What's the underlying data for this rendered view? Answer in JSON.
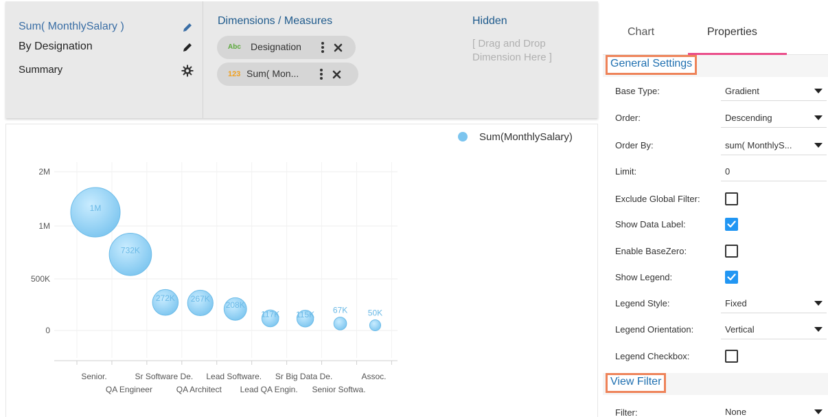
{
  "config": {
    "left": {
      "title": "Sum( MonthlySalary )",
      "by": "By Designation",
      "summary": "Summary"
    },
    "dimensions": {
      "heading": "Dimensions / Measures",
      "chips": [
        {
          "tag": "Abc",
          "label": "Designation"
        },
        {
          "tag": "123",
          "label": "Sum( Mon..."
        }
      ]
    },
    "hidden": {
      "heading": "Hidden",
      "hint": "[ Drag and Drop Dimension Here ]"
    }
  },
  "colors": {
    "bubble": "#7cc5ef",
    "accent_tab": "#ea4c89",
    "section_border": "#ee8359",
    "checkbox": "#2196f3",
    "tag_abc": "#5aa83a",
    "tag_123": "#f0a020"
  },
  "chart_data": {
    "type": "scatter",
    "legend": "Sum(MonthlySalary)",
    "legend_position": "top-right",
    "y_ticks": [
      "2M",
      "1M",
      "500K",
      "0"
    ],
    "x_tick_labels_row1": [
      "Senior.",
      "Sr Software De.",
      "Lead Software.",
      "Sr Big Data De.",
      "Assoc."
    ],
    "x_tick_labels_row2": [
      "QA Engineer",
      "QA Architect",
      "Lead QA Engin.",
      "Senior Softwa."
    ],
    "categories": [
      "Senior.",
      "QA Engineer",
      "Sr Software De.",
      "QA Architect",
      "Lead Software.",
      "Lead QA Engin.",
      "Sr Big Data De.",
      "Senior Softwa.",
      "Assoc."
    ],
    "values": [
      1000000,
      732000,
      272000,
      267000,
      208000,
      117000,
      115000,
      67000,
      50000
    ],
    "labels": [
      "1M",
      "732K",
      "272K",
      "267K",
      "208K",
      "117K",
      "115K",
      "67K",
      "50K"
    ],
    "grid": true
  },
  "properties": {
    "tabs": [
      "Chart",
      "Properties"
    ],
    "active_tab": "Properties",
    "general_settings": "General Settings",
    "view_filter": "View Filter",
    "rows": [
      {
        "label": "Base Type:",
        "kind": "dropdown",
        "value": "Gradient"
      },
      {
        "label": "Order:",
        "kind": "dropdown",
        "value": "Descending"
      },
      {
        "label": "Order By:",
        "kind": "dropdown",
        "value": "sum( MonthlyS..."
      },
      {
        "label": "Limit:",
        "kind": "input",
        "value": "0"
      },
      {
        "label": "Exclude Global Filter:",
        "kind": "checkbox",
        "checked": false
      },
      {
        "label": "Show Data Label:",
        "kind": "checkbox",
        "checked": true
      },
      {
        "label": "Enable BaseZero:",
        "kind": "checkbox",
        "checked": false
      },
      {
        "label": "Show Legend:",
        "kind": "checkbox",
        "checked": true
      },
      {
        "label": "Legend Style:",
        "kind": "dropdown",
        "value": "Fixed"
      },
      {
        "label": "Legend Orientation:",
        "kind": "dropdown",
        "value": "Vertical"
      },
      {
        "label": "Legend Checkbox:",
        "kind": "checkbox",
        "checked": false
      }
    ],
    "filter": {
      "label": "Filter:",
      "value": "None"
    }
  }
}
